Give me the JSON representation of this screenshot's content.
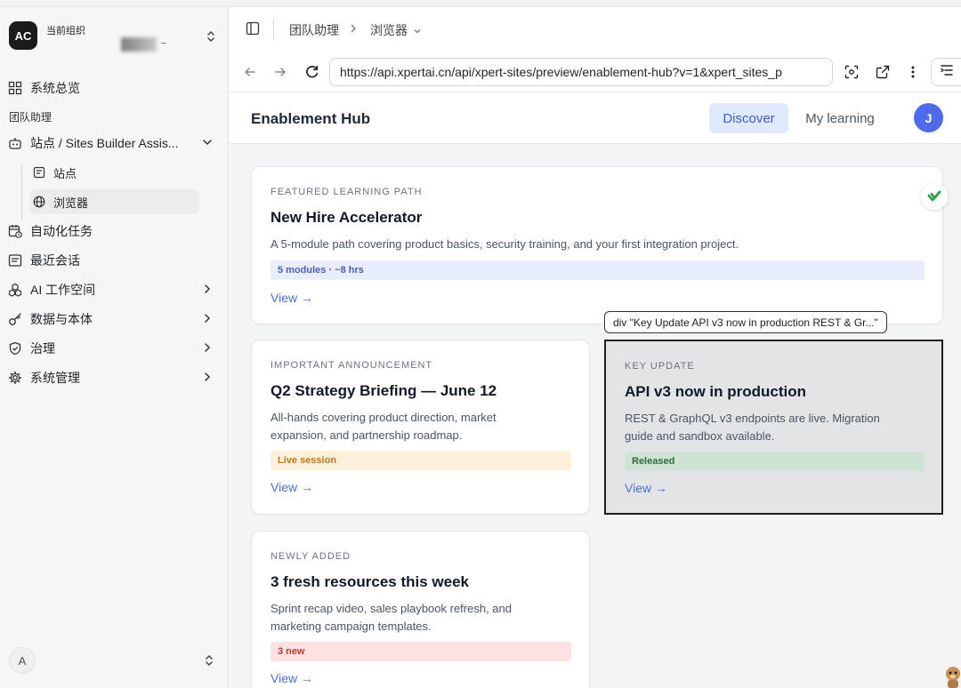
{
  "sidebar": {
    "org": {
      "avatar_initials": "AC",
      "label": "当前组织"
    },
    "nav": {
      "overview": "系统总览",
      "section_label": "团队助理",
      "site_builder": "站点 / Sites Builder Assis...",
      "sub_sites": "站点",
      "sub_browser": "浏览器",
      "automation": "自动化任务",
      "recent_chats": "最近会话",
      "ai_workspace": "AI 工作空间",
      "data_ontology": "数据与本体",
      "governance": "治理",
      "system_admin": "系统管理"
    },
    "user": {
      "initial": "A"
    }
  },
  "header": {
    "breadcrumb": [
      "团队助理",
      "浏览器"
    ]
  },
  "browser": {
    "url": "https://api.xpertai.cn/api/xpert-sites/preview/enablement-hub?v=1&xpert_sites_p",
    "icons": [
      "back-icon",
      "forward-icon",
      "reload-icon",
      "screenshot-icon",
      "external-link-icon",
      "more-icon",
      "panel-icon"
    ]
  },
  "hub": {
    "title": "Enablement Hub",
    "tabs": {
      "discover": "Discover",
      "my_learning": "My learning"
    },
    "avatar": "J",
    "view_label": "View →",
    "cards": {
      "featured": {
        "eyebrow": "FEATURED LEARNING PATH",
        "title": "New Hire Accelerator",
        "desc": "A 5-module path covering product basics, security training, and your first integration project.",
        "tag": "5 modules · ~8 hrs"
      },
      "announcement": {
        "eyebrow": "IMPORTANT ANNOUNCEMENT",
        "title": "Q2 Strategy Briefing — June 12",
        "desc_1": "All-hands covering product direction, market",
        "desc_2": "expansion, and partnership roadmap.",
        "tag": "Live session"
      },
      "key_update": {
        "eyebrow": "KEY UPDATE",
        "title": "API v3 now in production",
        "desc_1": "REST & GraphQL v3 endpoints are live. Migration",
        "desc_2": "guide and sandbox available.",
        "tag": "Released"
      },
      "newly_added": {
        "eyebrow": "NEWLY ADDED",
        "title": "3 fresh resources this week",
        "desc_1": "Sprint recap video, sales playbook refresh, and",
        "desc_2": "marketing campaign templates.",
        "tag": "3 new"
      }
    },
    "tooltip": "div \"Key Update API v3 now in production REST & Gr...\""
  },
  "colors": {
    "accent_blue": "#4b6fd6",
    "tag_blue_bg": "#e8eeff",
    "tag_orange_bg": "#fff1d9",
    "tag_green_bg": "#cfe3d4",
    "tag_red_bg": "#fde2e4"
  }
}
